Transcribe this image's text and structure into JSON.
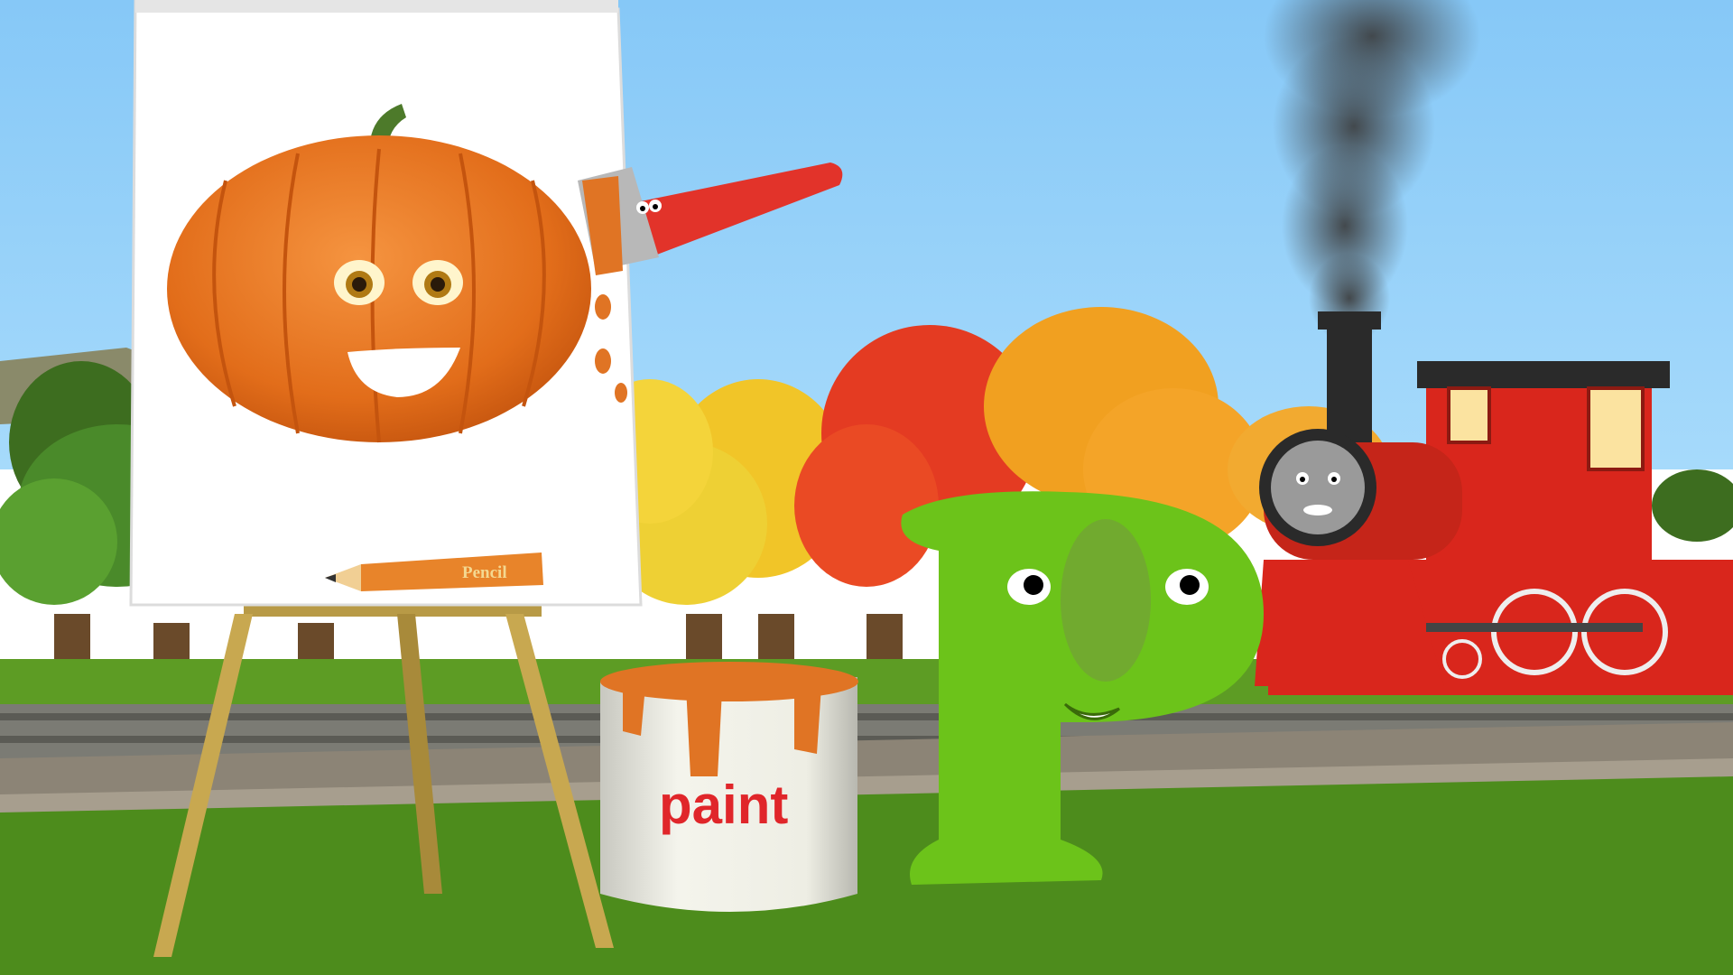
{
  "scene": {
    "paint_can_label": "paint",
    "pencil_label": "Pencil",
    "letter": "P"
  },
  "colors": {
    "sky": "#8ecdf8",
    "grass": "#4f8f1c",
    "pumpkin": "#e8731e",
    "letter": "#6cc31a",
    "train": "#e0261c",
    "paint_text": "#e0262a"
  }
}
